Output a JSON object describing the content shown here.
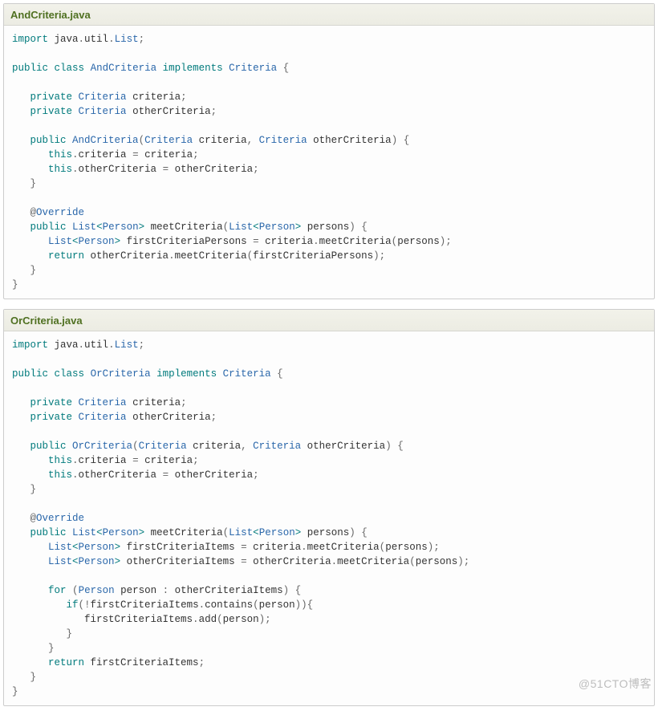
{
  "watermark": "@51CTO博客",
  "blocks": [
    {
      "title": "AndCriteria.java",
      "lines": [
        [
          [
            "kw",
            "import"
          ],
          [
            "plain",
            " java"
          ],
          [
            "punc",
            "."
          ],
          [
            "plain",
            "util"
          ],
          [
            "punc",
            "."
          ],
          [
            "type",
            "List"
          ],
          [
            "punc",
            ";"
          ]
        ],
        [],
        [
          [
            "kw",
            "public"
          ],
          [
            "plain",
            " "
          ],
          [
            "kw",
            "class"
          ],
          [
            "plain",
            " "
          ],
          [
            "type",
            "AndCriteria"
          ],
          [
            "plain",
            " "
          ],
          [
            "kw",
            "implements"
          ],
          [
            "plain",
            " "
          ],
          [
            "type",
            "Criteria"
          ],
          [
            "plain",
            " "
          ],
          [
            "punc",
            "{"
          ]
        ],
        [],
        [
          [
            "plain",
            "   "
          ],
          [
            "kw",
            "private"
          ],
          [
            "plain",
            " "
          ],
          [
            "type",
            "Criteria"
          ],
          [
            "plain",
            " criteria"
          ],
          [
            "punc",
            ";"
          ]
        ],
        [
          [
            "plain",
            "   "
          ],
          [
            "kw",
            "private"
          ],
          [
            "plain",
            " "
          ],
          [
            "type",
            "Criteria"
          ],
          [
            "plain",
            " otherCriteria"
          ],
          [
            "punc",
            ";"
          ]
        ],
        [],
        [
          [
            "plain",
            "   "
          ],
          [
            "kw",
            "public"
          ],
          [
            "plain",
            " "
          ],
          [
            "type",
            "AndCriteria"
          ],
          [
            "punc",
            "("
          ],
          [
            "type",
            "Criteria"
          ],
          [
            "plain",
            " criteria"
          ],
          [
            "punc",
            ","
          ],
          [
            "plain",
            " "
          ],
          [
            "type",
            "Criteria"
          ],
          [
            "plain",
            " otherCriteria"
          ],
          [
            "punc",
            ")"
          ],
          [
            "plain",
            " "
          ],
          [
            "punc",
            "{"
          ]
        ],
        [
          [
            "plain",
            "      "
          ],
          [
            "kw",
            "this"
          ],
          [
            "punc",
            "."
          ],
          [
            "plain",
            "criteria "
          ],
          [
            "punc",
            "="
          ],
          [
            "plain",
            " criteria"
          ],
          [
            "punc",
            ";"
          ]
        ],
        [
          [
            "plain",
            "      "
          ],
          [
            "kw",
            "this"
          ],
          [
            "punc",
            "."
          ],
          [
            "plain",
            "otherCriteria "
          ],
          [
            "punc",
            "="
          ],
          [
            "plain",
            " otherCriteria"
          ],
          [
            "punc",
            ";"
          ]
        ],
        [
          [
            "plain",
            "   "
          ],
          [
            "punc",
            "}"
          ]
        ],
        [],
        [
          [
            "plain",
            "   "
          ],
          [
            "at",
            "@"
          ],
          [
            "type",
            "Override"
          ]
        ],
        [
          [
            "plain",
            "   "
          ],
          [
            "kw",
            "public"
          ],
          [
            "plain",
            " "
          ],
          [
            "type",
            "List"
          ],
          [
            "gen",
            "<"
          ],
          [
            "type",
            "Person"
          ],
          [
            "gen",
            ">"
          ],
          [
            "plain",
            " meetCriteria"
          ],
          [
            "punc",
            "("
          ],
          [
            "type",
            "List"
          ],
          [
            "gen",
            "<"
          ],
          [
            "type",
            "Person"
          ],
          [
            "gen",
            ">"
          ],
          [
            "plain",
            " persons"
          ],
          [
            "punc",
            ")"
          ],
          [
            "plain",
            " "
          ],
          [
            "punc",
            "{"
          ]
        ],
        [
          [
            "plain",
            "      "
          ],
          [
            "type",
            "List"
          ],
          [
            "gen",
            "<"
          ],
          [
            "type",
            "Person"
          ],
          [
            "gen",
            ">"
          ],
          [
            "plain",
            " firstCriteriaPersons "
          ],
          [
            "punc",
            "="
          ],
          [
            "plain",
            " criteria"
          ],
          [
            "punc",
            "."
          ],
          [
            "plain",
            "meetCriteria"
          ],
          [
            "punc",
            "("
          ],
          [
            "plain",
            "persons"
          ],
          [
            "punc",
            ")"
          ],
          [
            "punc",
            ";"
          ]
        ],
        [
          [
            "plain",
            "      "
          ],
          [
            "kw",
            "return"
          ],
          [
            "plain",
            " otherCriteria"
          ],
          [
            "punc",
            "."
          ],
          [
            "plain",
            "meetCriteria"
          ],
          [
            "punc",
            "("
          ],
          [
            "plain",
            "firstCriteriaPersons"
          ],
          [
            "punc",
            ")"
          ],
          [
            "punc",
            ";"
          ]
        ],
        [
          [
            "plain",
            "   "
          ],
          [
            "punc",
            "}"
          ]
        ],
        [
          [
            "punc",
            "}"
          ]
        ]
      ]
    },
    {
      "title": "OrCriteria.java",
      "lines": [
        [
          [
            "kw",
            "import"
          ],
          [
            "plain",
            " java"
          ],
          [
            "punc",
            "."
          ],
          [
            "plain",
            "util"
          ],
          [
            "punc",
            "."
          ],
          [
            "type",
            "List"
          ],
          [
            "punc",
            ";"
          ]
        ],
        [],
        [
          [
            "kw",
            "public"
          ],
          [
            "plain",
            " "
          ],
          [
            "kw",
            "class"
          ],
          [
            "plain",
            " "
          ],
          [
            "type",
            "OrCriteria"
          ],
          [
            "plain",
            " "
          ],
          [
            "kw",
            "implements"
          ],
          [
            "plain",
            " "
          ],
          [
            "type",
            "Criteria"
          ],
          [
            "plain",
            " "
          ],
          [
            "punc",
            "{"
          ]
        ],
        [],
        [
          [
            "plain",
            "   "
          ],
          [
            "kw",
            "private"
          ],
          [
            "plain",
            " "
          ],
          [
            "type",
            "Criteria"
          ],
          [
            "plain",
            " criteria"
          ],
          [
            "punc",
            ";"
          ]
        ],
        [
          [
            "plain",
            "   "
          ],
          [
            "kw",
            "private"
          ],
          [
            "plain",
            " "
          ],
          [
            "type",
            "Criteria"
          ],
          [
            "plain",
            " otherCriteria"
          ],
          [
            "punc",
            ";"
          ]
        ],
        [],
        [
          [
            "plain",
            "   "
          ],
          [
            "kw",
            "public"
          ],
          [
            "plain",
            " "
          ],
          [
            "type",
            "OrCriteria"
          ],
          [
            "punc",
            "("
          ],
          [
            "type",
            "Criteria"
          ],
          [
            "plain",
            " criteria"
          ],
          [
            "punc",
            ","
          ],
          [
            "plain",
            " "
          ],
          [
            "type",
            "Criteria"
          ],
          [
            "plain",
            " otherCriteria"
          ],
          [
            "punc",
            ")"
          ],
          [
            "plain",
            " "
          ],
          [
            "punc",
            "{"
          ]
        ],
        [
          [
            "plain",
            "      "
          ],
          [
            "kw",
            "this"
          ],
          [
            "punc",
            "."
          ],
          [
            "plain",
            "criteria "
          ],
          [
            "punc",
            "="
          ],
          [
            "plain",
            " criteria"
          ],
          [
            "punc",
            ";"
          ]
        ],
        [
          [
            "plain",
            "      "
          ],
          [
            "kw",
            "this"
          ],
          [
            "punc",
            "."
          ],
          [
            "plain",
            "otherCriteria "
          ],
          [
            "punc",
            "="
          ],
          [
            "plain",
            " otherCriteria"
          ],
          [
            "punc",
            ";"
          ]
        ],
        [
          [
            "plain",
            "   "
          ],
          [
            "punc",
            "}"
          ]
        ],
        [],
        [
          [
            "plain",
            "   "
          ],
          [
            "at",
            "@"
          ],
          [
            "type",
            "Override"
          ]
        ],
        [
          [
            "plain",
            "   "
          ],
          [
            "kw",
            "public"
          ],
          [
            "plain",
            " "
          ],
          [
            "type",
            "List"
          ],
          [
            "gen",
            "<"
          ],
          [
            "type",
            "Person"
          ],
          [
            "gen",
            ">"
          ],
          [
            "plain",
            " meetCriteria"
          ],
          [
            "punc",
            "("
          ],
          [
            "type",
            "List"
          ],
          [
            "gen",
            "<"
          ],
          [
            "type",
            "Person"
          ],
          [
            "gen",
            ">"
          ],
          [
            "plain",
            " persons"
          ],
          [
            "punc",
            ")"
          ],
          [
            "plain",
            " "
          ],
          [
            "punc",
            "{"
          ]
        ],
        [
          [
            "plain",
            "      "
          ],
          [
            "type",
            "List"
          ],
          [
            "gen",
            "<"
          ],
          [
            "type",
            "Person"
          ],
          [
            "gen",
            ">"
          ],
          [
            "plain",
            " firstCriteriaItems "
          ],
          [
            "punc",
            "="
          ],
          [
            "plain",
            " criteria"
          ],
          [
            "punc",
            "."
          ],
          [
            "plain",
            "meetCriteria"
          ],
          [
            "punc",
            "("
          ],
          [
            "plain",
            "persons"
          ],
          [
            "punc",
            ")"
          ],
          [
            "punc",
            ";"
          ]
        ],
        [
          [
            "plain",
            "      "
          ],
          [
            "type",
            "List"
          ],
          [
            "gen",
            "<"
          ],
          [
            "type",
            "Person"
          ],
          [
            "gen",
            ">"
          ],
          [
            "plain",
            " otherCriteriaItems "
          ],
          [
            "punc",
            "="
          ],
          [
            "plain",
            " otherCriteria"
          ],
          [
            "punc",
            "."
          ],
          [
            "plain",
            "meetCriteria"
          ],
          [
            "punc",
            "("
          ],
          [
            "plain",
            "persons"
          ],
          [
            "punc",
            ")"
          ],
          [
            "punc",
            ";"
          ]
        ],
        [],
        [
          [
            "plain",
            "      "
          ],
          [
            "kw",
            "for"
          ],
          [
            "plain",
            " "
          ],
          [
            "punc",
            "("
          ],
          [
            "type",
            "Person"
          ],
          [
            "plain",
            " person "
          ],
          [
            "punc",
            ":"
          ],
          [
            "plain",
            " otherCriteriaItems"
          ],
          [
            "punc",
            ")"
          ],
          [
            "plain",
            " "
          ],
          [
            "punc",
            "{"
          ]
        ],
        [
          [
            "plain",
            "         "
          ],
          [
            "kw",
            "if"
          ],
          [
            "punc",
            "(!"
          ],
          [
            "plain",
            "firstCriteriaItems"
          ],
          [
            "punc",
            "."
          ],
          [
            "plain",
            "contains"
          ],
          [
            "punc",
            "("
          ],
          [
            "plain",
            "person"
          ],
          [
            "punc",
            "))"
          ],
          [
            "punc",
            "{"
          ]
        ],
        [
          [
            "plain",
            "            firstCriteriaItems"
          ],
          [
            "punc",
            "."
          ],
          [
            "plain",
            "add"
          ],
          [
            "punc",
            "("
          ],
          [
            "plain",
            "person"
          ],
          [
            "punc",
            ")"
          ],
          [
            "punc",
            ";"
          ]
        ],
        [
          [
            "plain",
            "         "
          ],
          [
            "punc",
            "}"
          ]
        ],
        [
          [
            "plain",
            "      "
          ],
          [
            "punc",
            "}"
          ]
        ],
        [
          [
            "plain",
            "      "
          ],
          [
            "kw",
            "return"
          ],
          [
            "plain",
            " firstCriteriaItems"
          ],
          [
            "punc",
            ";"
          ]
        ],
        [
          [
            "plain",
            "   "
          ],
          [
            "punc",
            "}"
          ]
        ],
        [
          [
            "punc",
            "}"
          ]
        ]
      ]
    }
  ]
}
